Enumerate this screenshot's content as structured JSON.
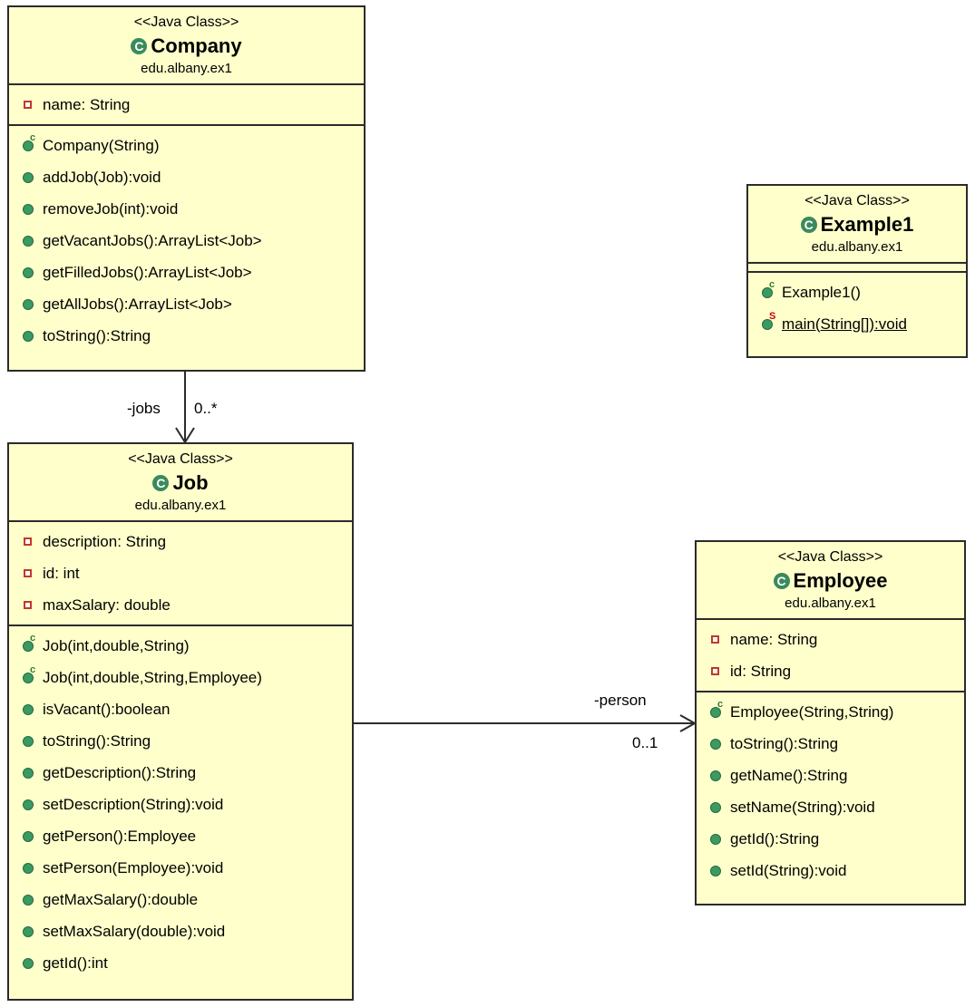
{
  "classes": {
    "company": {
      "stereotype": "<<Java Class>>",
      "name": "Company",
      "package": "edu.albany.ex1",
      "fields": [
        "name: String"
      ],
      "methods": [
        "Company(String)",
        "addJob(Job):void",
        "removeJob(int):void",
        "getVacantJobs():ArrayList<Job>",
        "getFilledJobs():ArrayList<Job>",
        "getAllJobs():ArrayList<Job>",
        "toString():String"
      ]
    },
    "example1": {
      "stereotype": "<<Java Class>>",
      "name": "Example1",
      "package": "edu.albany.ex1",
      "fields": [],
      "methods": [
        "Example1()",
        "main(String[]):void"
      ]
    },
    "job": {
      "stereotype": "<<Java Class>>",
      "name": "Job",
      "package": "edu.albany.ex1",
      "fields": [
        "description: String",
        "id: int",
        "maxSalary: double"
      ],
      "methods": [
        "Job(int,double,String)",
        "Job(int,double,String,Employee)",
        "isVacant():boolean",
        "toString():String",
        "getDescription():String",
        "setDescription(String):void",
        "getPerson():Employee",
        "setPerson(Employee):void",
        "getMaxSalary():double",
        "setMaxSalary(double):void",
        "getId():int"
      ]
    },
    "employee": {
      "stereotype": "<<Java Class>>",
      "name": "Employee",
      "package": "edu.albany.ex1",
      "fields": [
        "name: String",
        "id: String"
      ],
      "methods": [
        "Employee(String,String)",
        "toString():String",
        "getName():String",
        "setName(String):void",
        "getId():String",
        "setId(String):void"
      ]
    }
  },
  "associations": {
    "company_job": {
      "role": "-jobs",
      "multiplicity": "0..*"
    },
    "job_employee": {
      "role": "-person",
      "multiplicity": "0..1"
    }
  },
  "icon_glyphs": {
    "class": "C",
    "constructor": "c",
    "static": "S"
  }
}
